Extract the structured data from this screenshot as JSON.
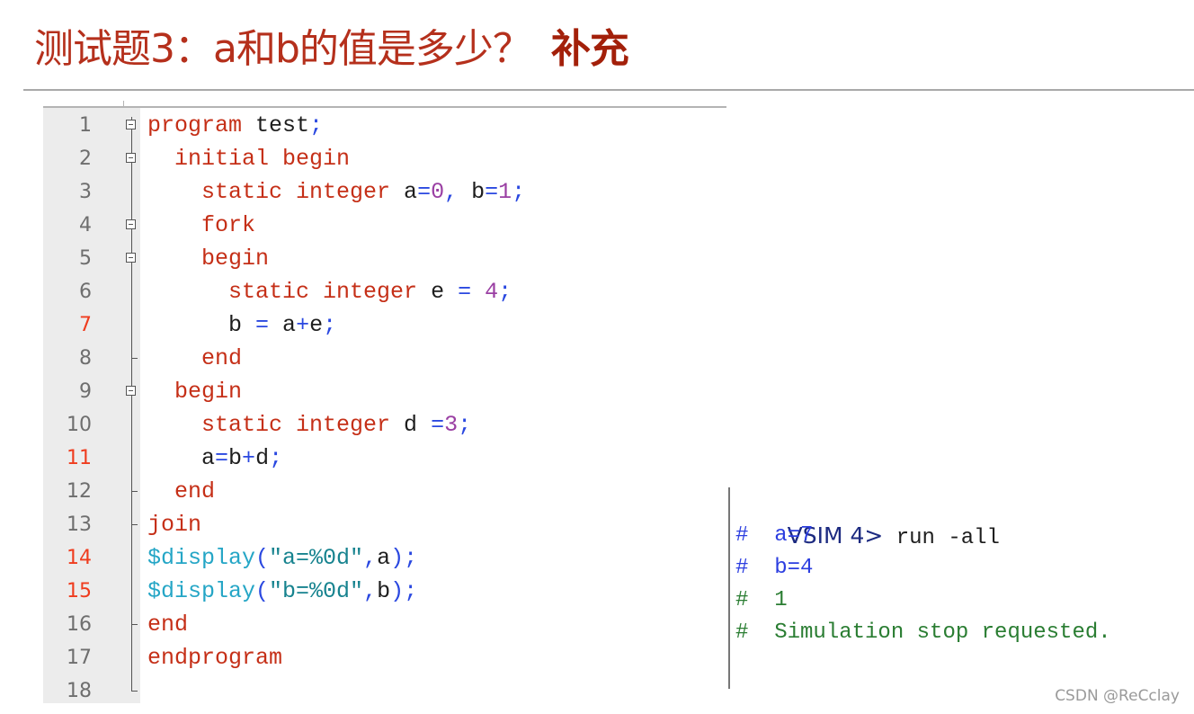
{
  "title": {
    "main": "测试题3：a和b的值是多少？",
    "suffix": "补充"
  },
  "editor": {
    "lines": [
      {
        "n": "1",
        "bp": false,
        "fold": "open",
        "tokens": [
          [
            "kw",
            "program"
          ],
          [
            "id",
            " test"
          ],
          [
            "op",
            ";"
          ]
        ]
      },
      {
        "n": "2",
        "bp": false,
        "fold": "open",
        "tokens": [
          [
            "kw",
            "  initial begin"
          ]
        ]
      },
      {
        "n": "3",
        "bp": false,
        "fold": "none",
        "tokens": [
          [
            "kw",
            "    static integer"
          ],
          [
            "id",
            " a"
          ],
          [
            "op",
            "="
          ],
          [
            "num",
            "0"
          ],
          [
            "op",
            ","
          ],
          [
            "id",
            " b"
          ],
          [
            "op",
            "="
          ],
          [
            "num",
            "1"
          ],
          [
            "op",
            ";"
          ]
        ]
      },
      {
        "n": "4",
        "bp": false,
        "fold": "open",
        "tokens": [
          [
            "kw",
            "    fork"
          ]
        ]
      },
      {
        "n": "5",
        "bp": false,
        "fold": "open",
        "tokens": [
          [
            "kw",
            "    begin"
          ]
        ]
      },
      {
        "n": "6",
        "bp": false,
        "fold": "none",
        "tokens": [
          [
            "kw",
            "      static integer"
          ],
          [
            "id",
            " e "
          ],
          [
            "op",
            "="
          ],
          [
            "num",
            " 4"
          ],
          [
            "op",
            ";"
          ]
        ]
      },
      {
        "n": "7",
        "bp": true,
        "fold": "none",
        "tokens": [
          [
            "id",
            "      b "
          ],
          [
            "op",
            "="
          ],
          [
            "id",
            " a"
          ],
          [
            "op",
            "+"
          ],
          [
            "id",
            "e"
          ],
          [
            "op",
            ";"
          ]
        ]
      },
      {
        "n": "8",
        "bp": false,
        "fold": "end",
        "tokens": [
          [
            "kw",
            "    end"
          ]
        ]
      },
      {
        "n": "9",
        "bp": false,
        "fold": "open",
        "tokens": [
          [
            "kw",
            "  begin"
          ]
        ]
      },
      {
        "n": "10",
        "bp": false,
        "fold": "none",
        "tokens": [
          [
            "kw",
            "    static integer"
          ],
          [
            "id",
            " d "
          ],
          [
            "op",
            "="
          ],
          [
            "num",
            "3"
          ],
          [
            "op",
            ";"
          ]
        ]
      },
      {
        "n": "11",
        "bp": true,
        "fold": "none",
        "tokens": [
          [
            "id",
            "    a"
          ],
          [
            "op",
            "="
          ],
          [
            "id",
            "b"
          ],
          [
            "op",
            "+"
          ],
          [
            "id",
            "d"
          ],
          [
            "op",
            ";"
          ]
        ]
      },
      {
        "n": "12",
        "bp": false,
        "fold": "end",
        "tokens": [
          [
            "kw",
            "  end"
          ]
        ]
      },
      {
        "n": "13",
        "bp": false,
        "fold": "end",
        "tokens": [
          [
            "kw",
            "join"
          ]
        ]
      },
      {
        "n": "14",
        "bp": true,
        "fold": "none",
        "tokens": [
          [
            "sys",
            "$display"
          ],
          [
            "op",
            "("
          ],
          [
            "str",
            "\"a=%0d\""
          ],
          [
            "op",
            ","
          ],
          [
            "id",
            "a"
          ],
          [
            "op",
            ");"
          ]
        ]
      },
      {
        "n": "15",
        "bp": true,
        "fold": "none",
        "tokens": [
          [
            "sys",
            "$display"
          ],
          [
            "op",
            "("
          ],
          [
            "str",
            "\"b=%0d\""
          ],
          [
            "op",
            ","
          ],
          [
            "id",
            "b"
          ],
          [
            "op",
            ");"
          ]
        ]
      },
      {
        "n": "16",
        "bp": false,
        "fold": "end",
        "tokens": [
          [
            "kw",
            "end"
          ]
        ]
      },
      {
        "n": "17",
        "bp": false,
        "fold": "none",
        "tokens": [
          [
            "kw",
            "endprogram"
          ]
        ]
      },
      {
        "n": "18",
        "bp": false,
        "fold": "last",
        "tokens": []
      }
    ]
  },
  "console": {
    "prompt": "VSIM 4>",
    "command": " run -all",
    "output": [
      {
        "text": "#  a=7",
        "color": "blue"
      },
      {
        "text": "#  b=4",
        "color": "blue"
      },
      {
        "text": "#  1",
        "color": "green"
      },
      {
        "text": "#  Simulation stop requested.",
        "color": "green"
      }
    ]
  },
  "watermark": "CSDN @ReCclay"
}
